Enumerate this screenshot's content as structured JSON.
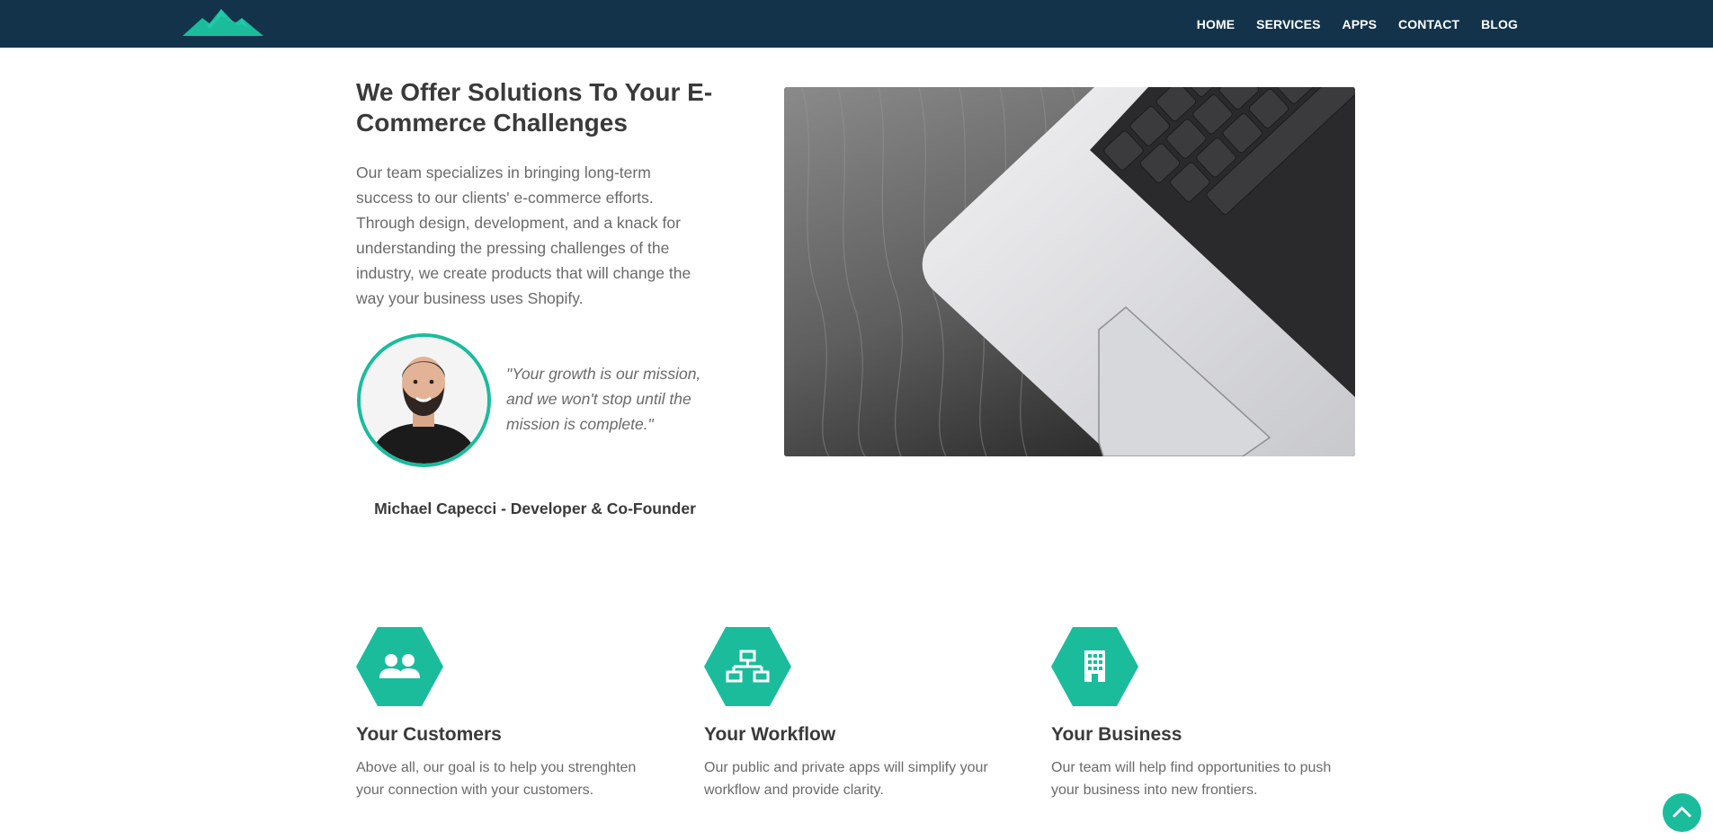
{
  "nav": {
    "links": [
      "HOME",
      "SERVICES",
      "APPS",
      "CONTACT",
      "BLOG"
    ]
  },
  "hero": {
    "title": "We Offer Solutions To Your E-Commerce Challenges",
    "text": "Our team specializes in bringing long-term success to our clients' e-commerce efforts. Through design, development, and a knack for understanding the pressing challenges of the industry, we create products that will change the way your business uses Shopify.",
    "quote": "\"Your growth is our mission, and we won't stop until the mission is complete.\"",
    "author": "Michael Capecci - Developer & Co-Founder"
  },
  "features": [
    {
      "icon": "users-icon",
      "title": "Your Customers",
      "text": "Above all, our goal is to help you strenghten your connection with your customers."
    },
    {
      "icon": "network-icon",
      "title": "Your Workflow",
      "text": "Our public and private apps will simplify your workflow and provide clarity."
    },
    {
      "icon": "building-icon",
      "title": "Your Business",
      "text": "Our team will help find opportunities to push your business into new frontiers."
    }
  ],
  "colors": {
    "navbar": "#12334a",
    "accent": "#1abc9c",
    "heading": "#3a3a3a",
    "body_text": "#6a6a6a"
  },
  "icons": {
    "logo": "mountain-logo",
    "scroll_top": "chevron-up-icon"
  }
}
